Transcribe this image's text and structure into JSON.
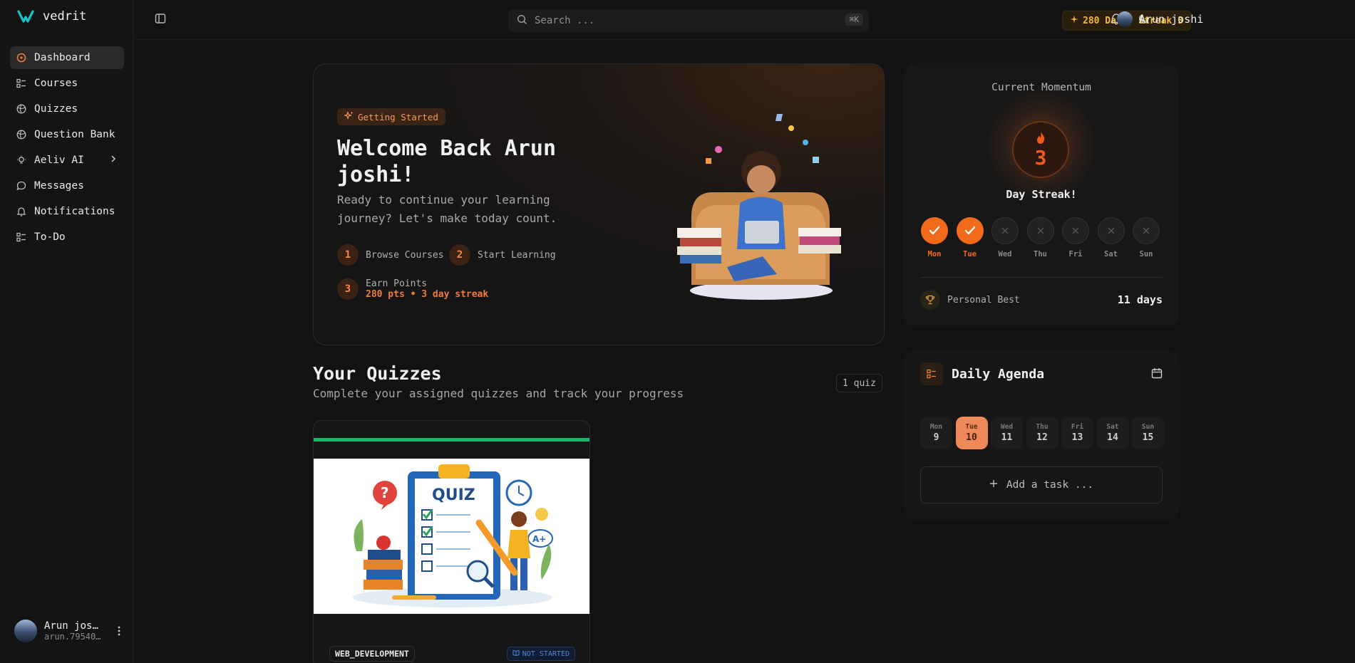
{
  "brand": {
    "name": "vedrit",
    "accent": "#18c6c9"
  },
  "sidebar": {
    "items": [
      {
        "label": "Dashboard",
        "icon": "dashboard-icon",
        "active": true
      },
      {
        "label": "Courses",
        "icon": "courses-icon"
      },
      {
        "label": "Quizzes",
        "icon": "quizzes-icon"
      },
      {
        "label": "Question Bank",
        "icon": "question-bank-icon"
      },
      {
        "label": "Aeliv AI",
        "icon": "lightbulb-icon",
        "has_submenu": true
      },
      {
        "label": "Messages",
        "icon": "message-icon"
      },
      {
        "label": "Notifications",
        "icon": "bell-icon"
      },
      {
        "label": "To-Do",
        "icon": "todo-icon"
      }
    ],
    "user": {
      "name": "Arun joshi",
      "email": "arun.79540..."
    }
  },
  "topbar": {
    "search_placeholder": "Search ...",
    "search_shortcut": "⌘K",
    "streak_label": "280 Daily Streak",
    "streak_count": "3",
    "user_name": "Arun joshi"
  },
  "hero": {
    "chip": "Getting Started",
    "title": "Welcome Back Arun joshi!",
    "subtitle": "Ready to continue your learning journey? Let's make today count.",
    "steps": [
      {
        "num": "1",
        "label": "Browse Courses"
      },
      {
        "num": "2",
        "label": "Start Learning"
      },
      {
        "num": "3",
        "label": "Earn Points",
        "sub": "280 pts • 3 day streak"
      }
    ]
  },
  "quizzes": {
    "title": "Your Quizzes",
    "subtitle": "Complete your assigned quizzes and track your progress",
    "count_label": "1 quiz",
    "items": [
      {
        "category": "WEB_DEVELOPMENT",
        "status": "NOT STARTED",
        "image_text": "QUIZ",
        "grade": "A+"
      }
    ]
  },
  "momentum": {
    "title": "Current Momentum",
    "streak_value": "3",
    "streak_label": "Day Streak!",
    "days": [
      {
        "label": "Mon",
        "done": true
      },
      {
        "label": "Tue",
        "done": true
      },
      {
        "label": "Wed",
        "done": false
      },
      {
        "label": "Thu",
        "done": false
      },
      {
        "label": "Fri",
        "done": false
      },
      {
        "label": "Sat",
        "done": false
      },
      {
        "label": "Sun",
        "done": false
      }
    ],
    "personal_best_label": "Personal Best",
    "personal_best_value": "11 days"
  },
  "agenda": {
    "title": "Daily Agenda",
    "days": [
      {
        "name": "Mon",
        "date": "9"
      },
      {
        "name": "Tue",
        "date": "10",
        "selected": true
      },
      {
        "name": "Wed",
        "date": "11"
      },
      {
        "name": "Thu",
        "date": "12"
      },
      {
        "name": "Fri",
        "date": "13"
      },
      {
        "name": "Sat",
        "date": "14"
      },
      {
        "name": "Sun",
        "date": "15"
      }
    ],
    "add_task_label": "Add a task ..."
  }
}
